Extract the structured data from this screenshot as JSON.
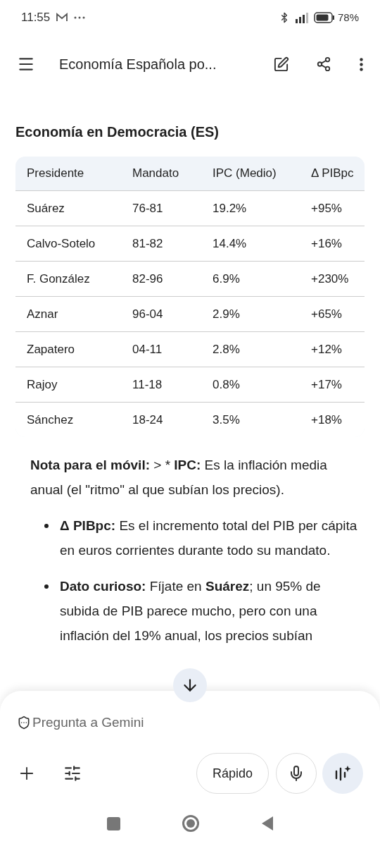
{
  "status_bar": {
    "time": "11:55",
    "battery": "78%"
  },
  "app_bar": {
    "title": "Economía Española po..."
  },
  "section_title": "Economía en Democracia (ES)",
  "table": {
    "columns": [
      "Presidente",
      "Mandato",
      "IPC (Medio)",
      "Δ PIBpc"
    ],
    "rows": [
      [
        "Suárez",
        "76-81",
        "19.2%",
        "+95%"
      ],
      [
        "Calvo-Sotelo",
        "81-82",
        "14.4%",
        "+16%"
      ],
      [
        "F. González",
        "82-96",
        "6.9%",
        "+230%"
      ],
      [
        "Aznar",
        "96-04",
        "2.9%",
        "+65%"
      ],
      [
        "Zapatero",
        "04-11",
        "2.8%",
        "+12%"
      ],
      [
        "Rajoy",
        "11-18",
        "0.8%",
        "+17%"
      ],
      [
        "Sánchez",
        "18-24",
        "3.5%",
        "+18%"
      ]
    ]
  },
  "note": [
    {
      "text": "Nota para el móvil:",
      "bold": true
    },
    {
      "text": " > * ",
      "bold": false
    },
    {
      "text": "IPC:",
      "bold": true
    },
    {
      "text": " Es la inflación media anual (el \"ritmo\" al que subían los precios).",
      "bold": false
    }
  ],
  "bullets": [
    [
      {
        "text": "Δ PIBpc:",
        "bold": true
      },
      {
        "text": " Es el incremento total del PIB per cápita en euros corrientes durante todo su mandato.",
        "bold": false
      }
    ],
    [
      {
        "text": "Dato curioso:",
        "bold": true
      },
      {
        "text": " Fíjate en ",
        "bold": false
      },
      {
        "text": "Suárez",
        "bold": true
      },
      {
        "text": "; un 95% de subida de PIB parece mucho, pero con una inflación del 19% anual, los precios subían",
        "bold": false
      }
    ]
  ],
  "composer": {
    "placeholder": "Pregunta a Gemini",
    "mode_button": "Rápido"
  }
}
